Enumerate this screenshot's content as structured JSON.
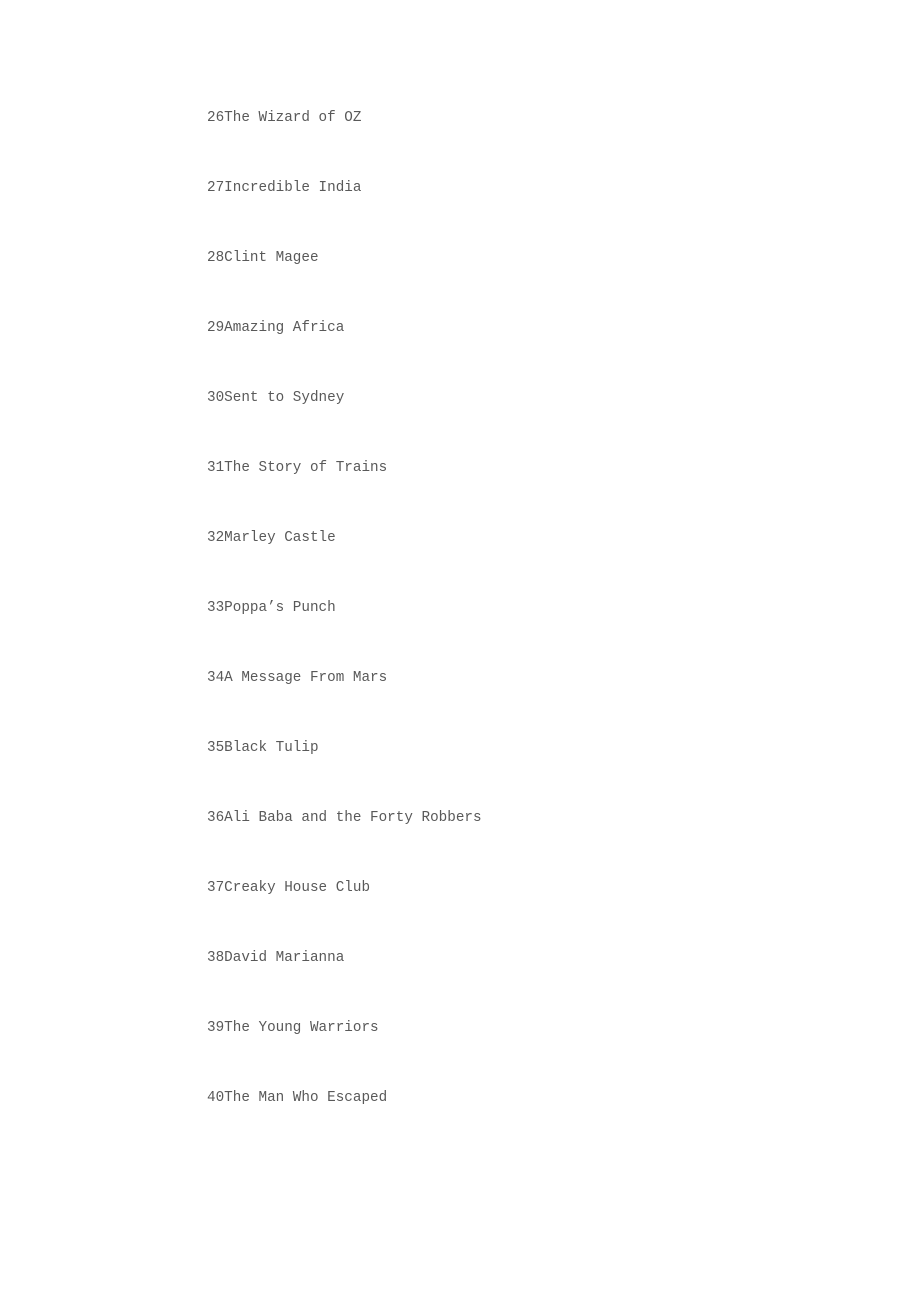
{
  "document": {
    "kind": "plain-text-list",
    "page_background": "#ffffff",
    "text_color": "#595959",
    "entries": [
      {
        "number": "26",
        "title": "The Wizard of OZ"
      },
      {
        "number": "27",
        "title": "Incredible India"
      },
      {
        "number": "28",
        "title": "Clint Magee"
      },
      {
        "number": "29",
        "title": "Amazing Africa"
      },
      {
        "number": "30",
        "title": "Sent to Sydney"
      },
      {
        "number": "31",
        "title": "The Story of Trains"
      },
      {
        "number": "32",
        "title": "Marley Castle"
      },
      {
        "number": "33",
        "title": "Poppa’s Punch"
      },
      {
        "number": "34",
        "title": "A Message From Mars"
      },
      {
        "number": "35",
        "title": "Black Tulip"
      },
      {
        "number": "36",
        "title": "Ali Baba and the Forty Robbers"
      },
      {
        "number": "37",
        "title": "Creaky House Club"
      },
      {
        "number": "38",
        "title": "David Marianna"
      },
      {
        "number": "39",
        "title": "The Young Warriors"
      },
      {
        "number": "40",
        "title": "The Man Who Escaped"
      }
    ]
  }
}
